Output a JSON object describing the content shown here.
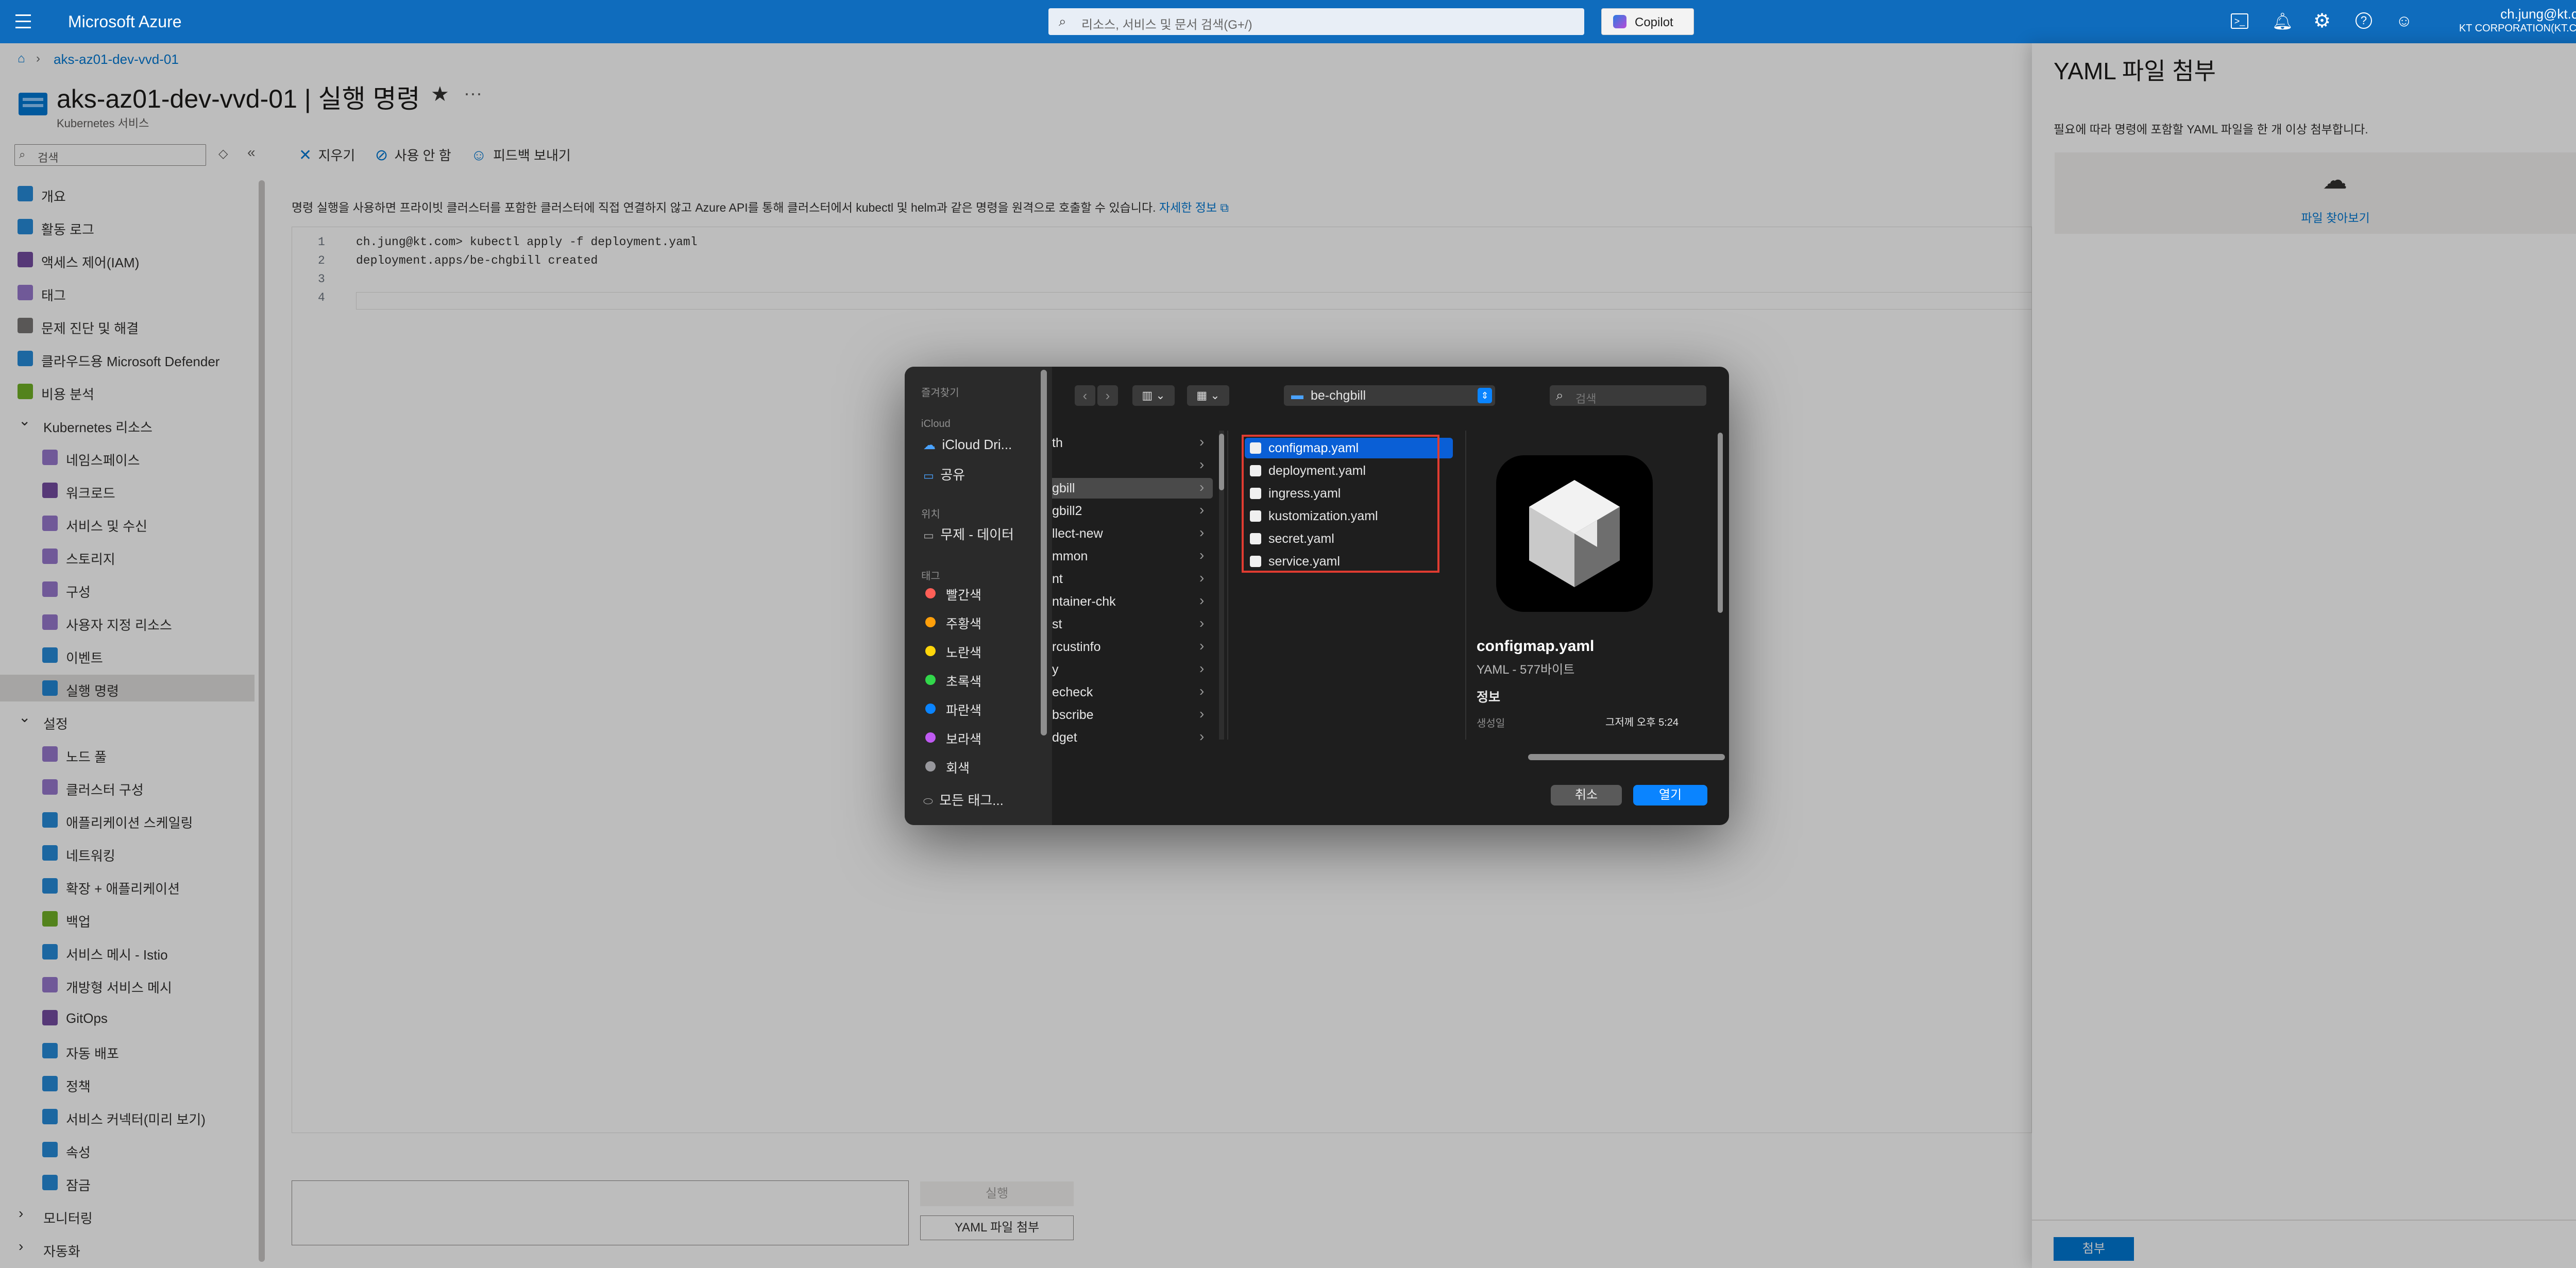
{
  "topbar": {
    "brand": "Microsoft Azure",
    "search_placeholder": "리소스, 서비스 및 문서 검색(G+/)",
    "copilot_label": "Copilot",
    "user_email": "ch.jung@kt.com",
    "user_org": "KT CORPORATION(KT.COM)"
  },
  "breadcrumb": {
    "item": "aks-az01-dev-vvd-01"
  },
  "page": {
    "title": "aks-az01-dev-vvd-01 | 실행 명령",
    "subtitle": "Kubernetes 서비스"
  },
  "sidebar": {
    "search_placeholder": "검색",
    "items": [
      {
        "label": "개요",
        "indent": 0,
        "color": "#0078d4"
      },
      {
        "label": "활동 로그",
        "indent": 0,
        "color": "#0078d4"
      },
      {
        "label": "액세스 제어(IAM)",
        "indent": 0,
        "color": "#5c2d91"
      },
      {
        "label": "태그",
        "indent": 0,
        "color": "#8661c5"
      },
      {
        "label": "문제 진단 및 해결",
        "indent": 0,
        "color": "#605e5c"
      },
      {
        "label": "클라우드용 Microsoft Defender",
        "indent": 0,
        "color": "#0078d4"
      },
      {
        "label": "비용 분석",
        "indent": 0,
        "color": "#57a300"
      },
      {
        "label": "Kubernetes 리소스",
        "indent": 0,
        "group": true
      },
      {
        "label": "네임스페이스",
        "indent": 1,
        "color": "#8661c5"
      },
      {
        "label": "워크로드",
        "indent": 1,
        "color": "#5c2d91"
      },
      {
        "label": "서비스 및 수신",
        "indent": 1,
        "color": "#8661c5"
      },
      {
        "label": "스토리지",
        "indent": 1,
        "color": "#8661c5"
      },
      {
        "label": "구성",
        "indent": 1,
        "color": "#8661c5"
      },
      {
        "label": "사용자 지정 리소스",
        "indent": 1,
        "color": "#8661c5"
      },
      {
        "label": "이벤트",
        "indent": 1,
        "color": "#0078d4"
      },
      {
        "label": "실행 명령",
        "indent": 1,
        "color": "#0078d4",
        "selected": true
      },
      {
        "label": "설정",
        "indent": 0,
        "group": true
      },
      {
        "label": "노드 풀",
        "indent": 1,
        "color": "#8661c5"
      },
      {
        "label": "클러스터 구성",
        "indent": 1,
        "color": "#8661c5"
      },
      {
        "label": "애플리케이션 스케일링",
        "indent": 1,
        "color": "#0078d4"
      },
      {
        "label": "네트워킹",
        "indent": 1,
        "color": "#0078d4"
      },
      {
        "label": "확장 + 애플리케이션",
        "indent": 1,
        "color": "#0078d4"
      },
      {
        "label": "백업",
        "indent": 1,
        "color": "#57a300"
      },
      {
        "label": "서비스 메시 - Istio",
        "indent": 1,
        "color": "#0078d4"
      },
      {
        "label": "개방형 서비스 메시",
        "indent": 1,
        "color": "#8661c5"
      },
      {
        "label": "GitOps",
        "indent": 1,
        "color": "#5c2d91"
      },
      {
        "label": "자동 배포",
        "indent": 1,
        "color": "#0078d4"
      },
      {
        "label": "정책",
        "indent": 1,
        "color": "#0078d4"
      },
      {
        "label": "서비스 커넥터(미리 보기)",
        "indent": 1,
        "color": "#0078d4"
      },
      {
        "label": "속성",
        "indent": 1,
        "color": "#0078d4"
      },
      {
        "label": "잠금",
        "indent": 1,
        "color": "#0078d4"
      },
      {
        "label": "모니터링",
        "indent": 0,
        "group": true,
        "collapsed": true
      },
      {
        "label": "자동화",
        "indent": 0,
        "group": true,
        "collapsed": true
      }
    ]
  },
  "toolbar": {
    "clear": "지우기",
    "disable": "사용 안 함",
    "feedback": "피드백 보내기"
  },
  "info": {
    "text": "명령 실행을 사용하면 프라이빗 클러스터를 포함한 클러스터에 직접 연결하지 않고 Azure API를 통해 클러스터에서 kubectl 및 helm과 같은 명령을 원격으로 호출할 수 있습니다.",
    "link": "자세한 정보"
  },
  "editor": {
    "lines": [
      {
        "num": "1",
        "text": "ch.jung@kt.com> kubectl apply -f deployment.yaml"
      },
      {
        "num": "2",
        "text": "deployment.apps/be-chgbill created"
      },
      {
        "num": "3",
        "text": ""
      },
      {
        "num": "4",
        "text": ""
      }
    ]
  },
  "bottom": {
    "run_label": "실행",
    "attach_label": "YAML 파일 첨부"
  },
  "panel": {
    "title": "YAML 파일 첨부",
    "description": "필요에 따라 명령에 포함할 YAML 파일을 한 개 이상 첨부합니다.",
    "browse_label": "파일 찾아보기",
    "attach_button": "첨부"
  },
  "dialog": {
    "sidebar": {
      "favorites": "즐겨찾기",
      "icloud": "iCloud",
      "icloud_drive": "iCloud Dri...",
      "shared": "공유",
      "location": "위치",
      "location_item": "무제 - 데이터",
      "tags": "태그",
      "tag_items": [
        {
          "label": "빨간색",
          "color": "#ff5f57"
        },
        {
          "label": "주황색",
          "color": "#ff9f0a"
        },
        {
          "label": "노란색",
          "color": "#ffd60a"
        },
        {
          "label": "초록색",
          "color": "#32d74b"
        },
        {
          "label": "파란색",
          "color": "#0a84ff"
        },
        {
          "label": "보라색",
          "color": "#bf5af2"
        },
        {
          "label": "회색",
          "color": "#98989d"
        }
      ],
      "all_tags": "모든 태그..."
    },
    "folder": "be-chgbill",
    "search_placeholder": "검색",
    "col1": [
      "th",
      "",
      "gbill",
      "gbill2",
      "llect-new",
      "mmon",
      "nt",
      "ntainer-chk",
      "st",
      "rcustinfo",
      "y",
      "echeck",
      "bscribe",
      "dget"
    ],
    "col1_selected": 2,
    "files": [
      "configmap.yaml",
      "deployment.yaml",
      "ingress.yaml",
      "kustomization.yaml",
      "secret.yaml",
      "service.yaml"
    ],
    "selected_file": 0,
    "preview": {
      "name": "configmap.yaml",
      "meta": "YAML - 577바이트",
      "info": "정보",
      "created_label": "생성일",
      "created_value": "그저께 오후 5:24"
    },
    "cancel": "취소",
    "open": "열기",
    "highlight_color": "#e03c31"
  }
}
